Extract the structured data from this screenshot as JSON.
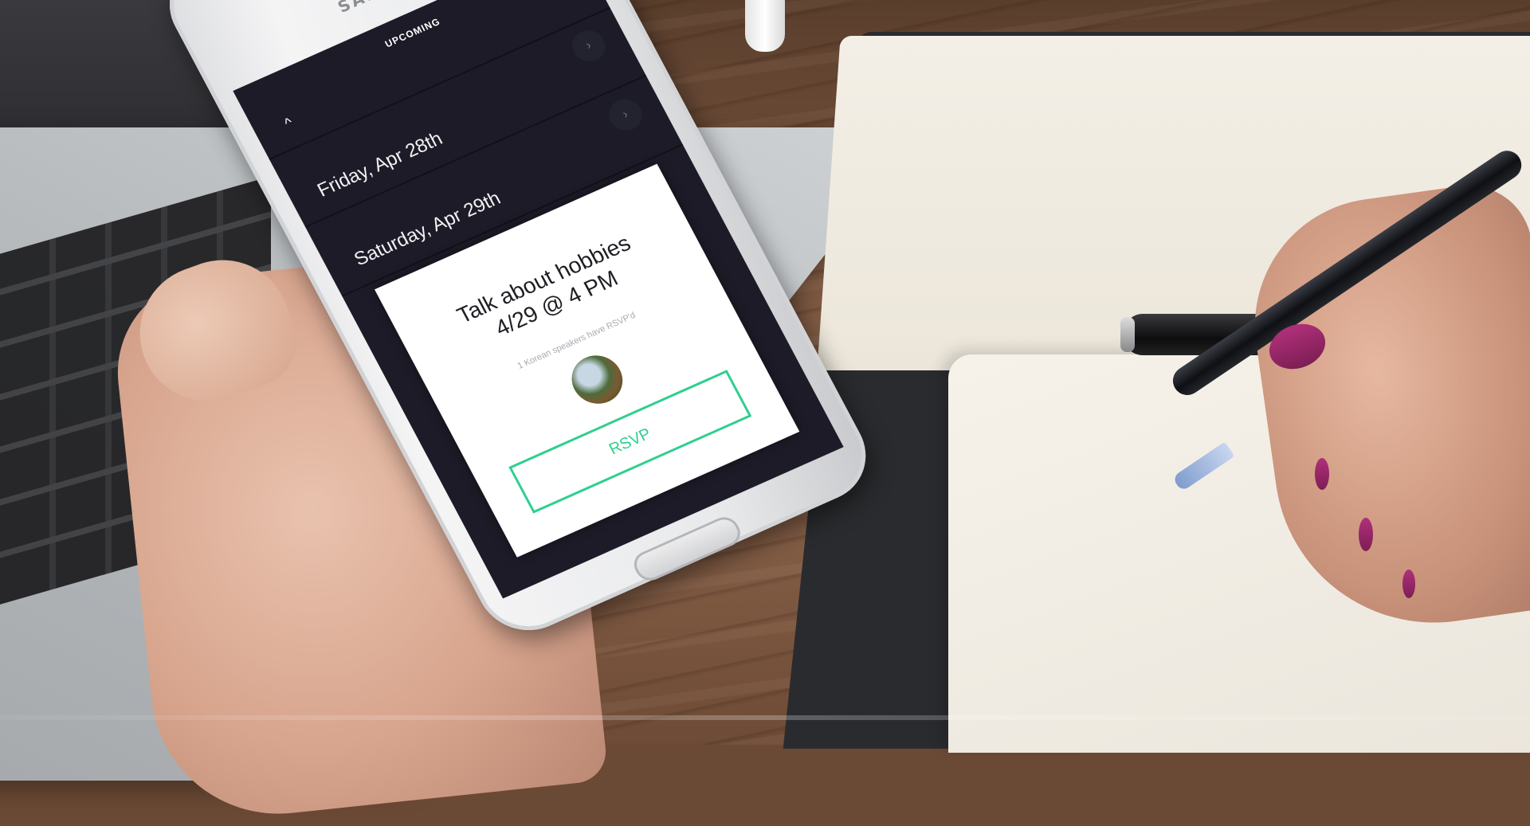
{
  "phone": {
    "brand": "SAMSUNG",
    "header": {
      "title": "UPCOMING",
      "back_icon": "chevron-up-icon"
    },
    "days": [
      {
        "date": "Friday, Apr 28th",
        "arrow_icon": "chevron-right-icon"
      },
      {
        "date": "Saturday, Apr 29th",
        "arrow_icon": "chevron-right-icon"
      }
    ],
    "event_card": {
      "title_line1": "Talk about hobbies",
      "title_line2": "4/29 @ 4 PM",
      "rsvp_count_text": "1 Korean speakers have RSVP'd",
      "avatar_icon": "avatar-photo",
      "rsvp_label": "RSVP"
    }
  },
  "colors": {
    "screen_background": "#1c1b27",
    "accent": "#2fcf8e",
    "card_background": "#ffffff"
  }
}
